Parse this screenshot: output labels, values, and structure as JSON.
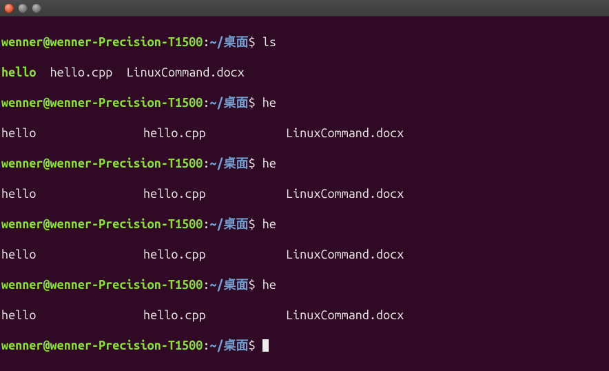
{
  "prompt": {
    "user_host": "wenner@wenner-Precision-T1500",
    "sep": ":",
    "path": "~/桌面",
    "symbol": "$"
  },
  "listing_simple": {
    "files": [
      "hello",
      "hello.cpp",
      "LinuxCommand.docx"
    ]
  },
  "listing_cols": {
    "col0": "hello",
    "col1": "hello.cpp",
    "col2": "LinuxCommand.docx"
  },
  "commands": {
    "ls": "ls",
    "he": "he"
  }
}
